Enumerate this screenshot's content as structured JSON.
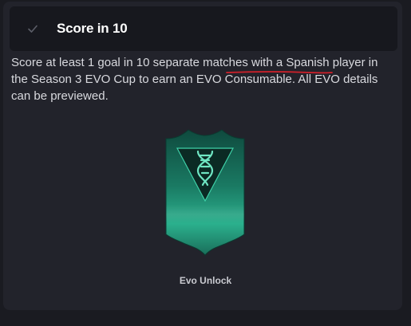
{
  "objective": {
    "status": "completed",
    "title": "Score in 10",
    "description": "Score at least 1 goal in 10 separate matches with a Spanish player in the Season 3 EVO Cup to earn an EVO Consumable. All EVO details can be previewed.",
    "annotation": "red underline beneath \"with a Spanish player\""
  },
  "reward": {
    "label": "Evo Unlock",
    "icon": "dna-icon"
  },
  "colors": {
    "background": "#1a1b21",
    "panel": "#22232b",
    "header": "#17181e",
    "card_green": "#1f8f72",
    "annotation_red": "#d0202a"
  }
}
